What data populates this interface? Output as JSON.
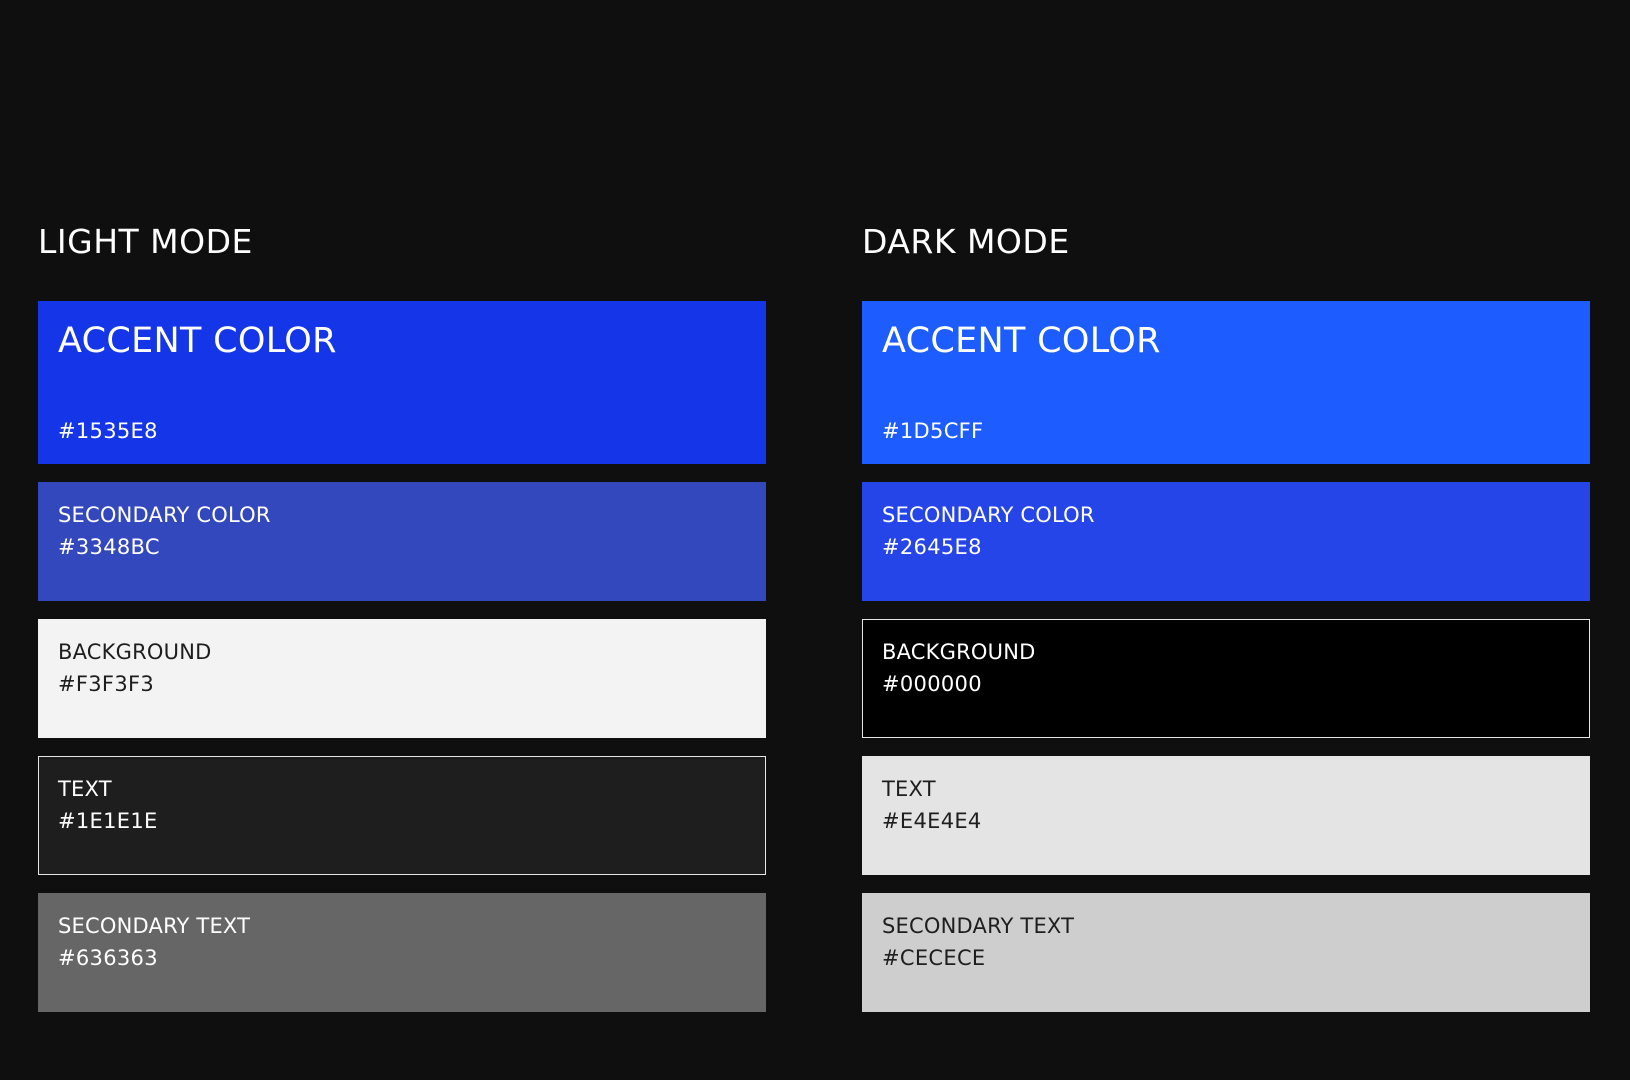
{
  "light_mode": {
    "title": "LIGHT MODE",
    "accent": {
      "label": "ACCENT COLOR",
      "hex": "#1535E8"
    },
    "secondary": {
      "label": "SECONDARY COLOR",
      "hex": "#3348BC"
    },
    "background": {
      "label": "BACKGROUND",
      "hex": "#F3F3F3"
    },
    "text": {
      "label": "TEXT",
      "hex": "#1E1E1E"
    },
    "secondary_text": {
      "label": "SECONDARY TEXT",
      "hex": "#636363"
    }
  },
  "dark_mode": {
    "title": "DARK MODE",
    "accent": {
      "label": "ACCENT COLOR",
      "hex": "#1D5CFF"
    },
    "secondary": {
      "label": "SECONDARY COLOR",
      "hex": "#2645E8"
    },
    "background": {
      "label": "BACKGROUND",
      "hex": "#000000"
    },
    "text": {
      "label": "TEXT",
      "hex": "#E4E4E4"
    },
    "secondary_text": {
      "label": "SECONDARY TEXT",
      "hex": "#CECECE"
    }
  }
}
